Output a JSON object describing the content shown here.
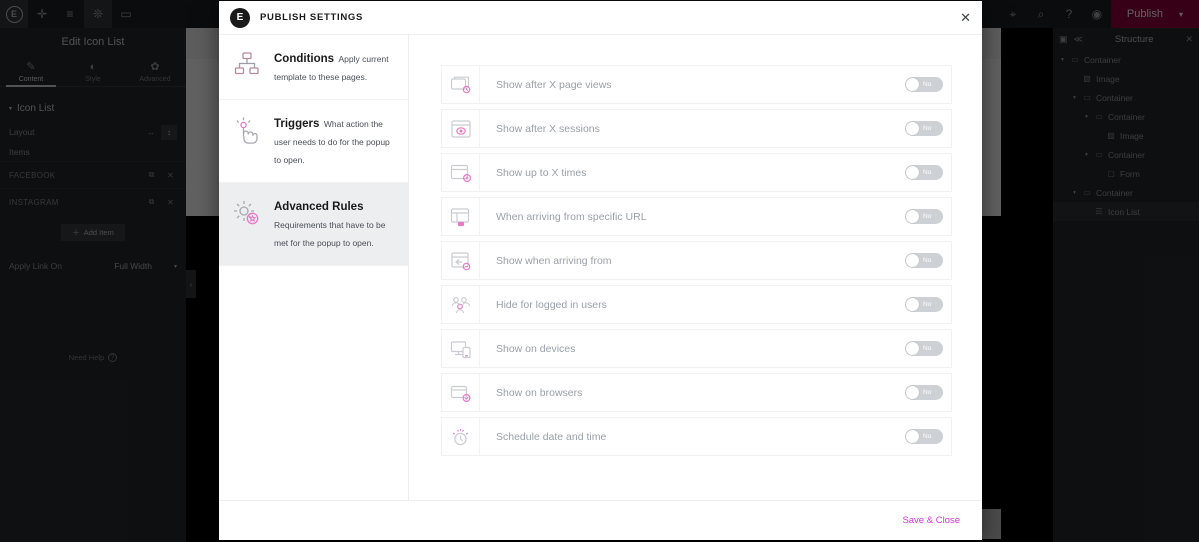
{
  "topbar": {
    "logo": "elementor-logo",
    "icons": [
      "add-icon",
      "layout-icon",
      "layers-icon",
      "comment-icon"
    ],
    "right_icons": [
      "settings-icon",
      "search-icon",
      "help-icon",
      "preview-icon"
    ],
    "publish_label": "Publish",
    "publish_color": "#92003b"
  },
  "left_panel": {
    "title": "Edit Icon List",
    "tabs": [
      {
        "label": "Content",
        "icon": "pencil-icon",
        "active": true
      },
      {
        "label": "Style",
        "icon": "contrast-icon",
        "active": false
      },
      {
        "label": "Advanced",
        "icon": "gear-icon",
        "active": false
      }
    ],
    "section_title": "Icon List",
    "layout_label": "Layout",
    "items_label": "Items",
    "items": [
      {
        "name": "FACEBOOK"
      },
      {
        "name": "INSTAGRAM"
      }
    ],
    "add_item_label": "Add Item",
    "apply_link_label": "Apply Link On",
    "apply_link_value": "Full Width",
    "need_help_label": "Need Help"
  },
  "structure": {
    "title": "Structure",
    "tree": [
      {
        "label": "Container",
        "depth": 0,
        "caret": true,
        "icon": "container-icon",
        "selected": false
      },
      {
        "label": "Image",
        "depth": 1,
        "caret": false,
        "icon": "image-icon",
        "selected": false
      },
      {
        "label": "Container",
        "depth": 1,
        "caret": true,
        "icon": "container-icon",
        "selected": false
      },
      {
        "label": "Container",
        "depth": 2,
        "caret": true,
        "icon": "container-icon",
        "selected": false
      },
      {
        "label": "Image",
        "depth": 3,
        "caret": false,
        "icon": "image-icon",
        "selected": false
      },
      {
        "label": "Container",
        "depth": 2,
        "caret": true,
        "icon": "container-icon",
        "selected": false
      },
      {
        "label": "Form",
        "depth": 3,
        "caret": false,
        "icon": "form-icon",
        "selected": false
      },
      {
        "label": "Container",
        "depth": 1,
        "caret": true,
        "icon": "container-icon",
        "selected": false
      },
      {
        "label": "Icon List",
        "depth": 2,
        "caret": false,
        "icon": "list-icon",
        "selected": true
      }
    ]
  },
  "modal": {
    "title": "PUBLISH SETTINGS",
    "close_icon": "close-icon",
    "sidebar": [
      {
        "title": "Conditions",
        "desc": "Apply current template to these pages.",
        "icon": "sitemap-icon",
        "active": false
      },
      {
        "title": "Triggers",
        "desc": "What action the user needs to do for the popup to open.",
        "icon": "click-hand-icon",
        "active": false
      },
      {
        "title": "Advanced Rules",
        "desc": "Requirements that have to be met for the popup to open.",
        "icon": "gear-star-icon",
        "active": true
      }
    ],
    "rules": [
      {
        "label": "Show after X page views",
        "icon": "page-views-icon",
        "toggle": "No"
      },
      {
        "label": "Show after X sessions",
        "icon": "sessions-icon",
        "toggle": "No"
      },
      {
        "label": "Show up to X times",
        "icon": "times-icon",
        "toggle": "No"
      },
      {
        "label": "When arriving from specific URL",
        "icon": "url-icon",
        "toggle": "No"
      },
      {
        "label": "Show when arriving from",
        "icon": "arriving-from-icon",
        "toggle": "No"
      },
      {
        "label": "Hide for logged in users",
        "icon": "users-icon",
        "toggle": "No"
      },
      {
        "label": "Show on devices",
        "icon": "devices-icon",
        "toggle": "No"
      },
      {
        "label": "Show on browsers",
        "icon": "browsers-icon",
        "toggle": "No"
      },
      {
        "label": "Schedule date and time",
        "icon": "schedule-icon",
        "toggle": "No"
      }
    ],
    "save_label": "Save & Close",
    "save_color": "#d833d8"
  }
}
